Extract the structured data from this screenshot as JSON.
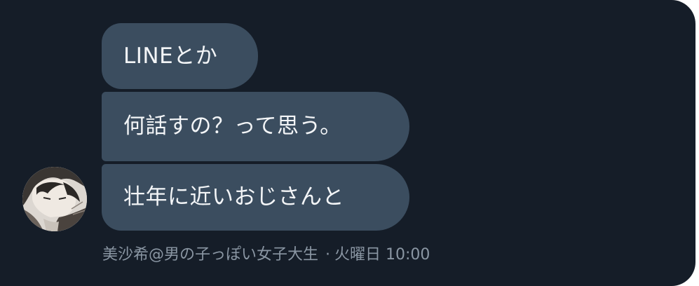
{
  "messages": [
    {
      "text": "LINEとか"
    },
    {
      "text": "何話すの？って思う。"
    },
    {
      "text": "壮年に近いおじさんと"
    }
  ],
  "sender": {
    "name": "美沙希@男の子っぽい女子大生",
    "separator": "·",
    "timestamp": "火曜日 10:00"
  },
  "colors": {
    "background": "#151d28",
    "bubble": "#3b4d5f",
    "bubble_text": "#f3f5f7",
    "meta_text": "#8a96a3"
  },
  "icons": {
    "avatar": "user-avatar-manga-portrait"
  }
}
